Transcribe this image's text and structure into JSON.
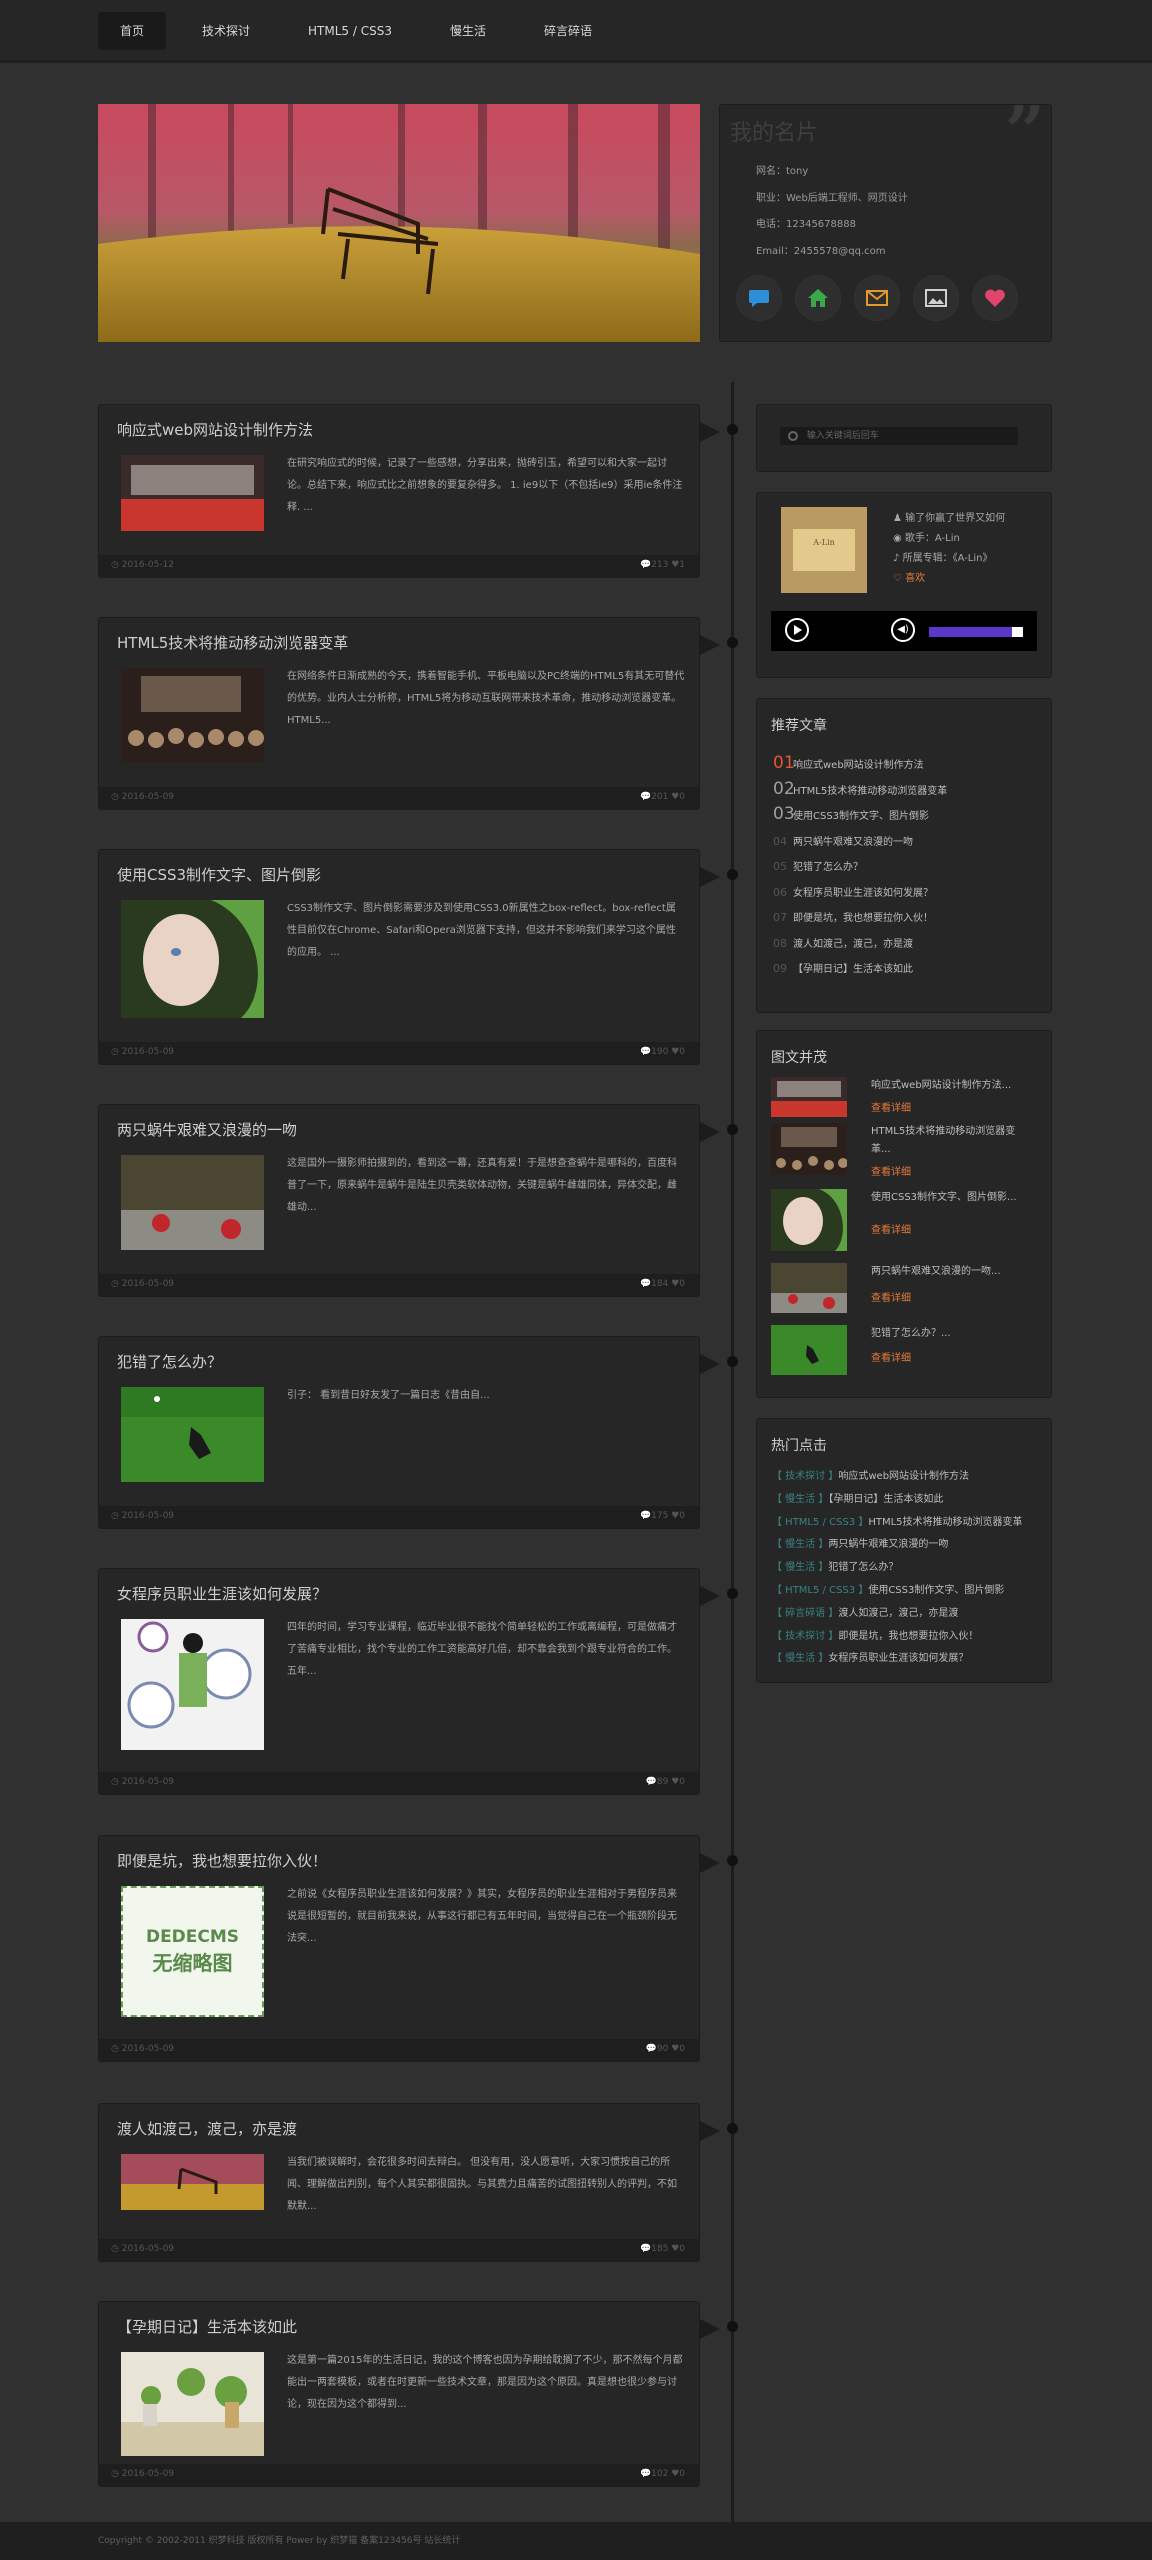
{
  "nav": [
    {
      "label": "首页",
      "active": true
    },
    {
      "label": "技术探讨",
      "active": false
    },
    {
      "label": "HTML5 / CSS3",
      "active": false
    },
    {
      "label": "慢生活",
      "active": false
    },
    {
      "label": "碎言碎语",
      "active": false
    }
  ],
  "profile": {
    "title": "我的名片",
    "name": "网名：tony",
    "job": "职业：Web后端工程师、网页设计",
    "phone": "电话：12345678888",
    "email": "Email：2455578@qq.com",
    "icons": [
      "chat-icon",
      "home-icon",
      "mail-icon",
      "picture-icon",
      "heart-icon"
    ]
  },
  "posts": [
    {
      "title": "响应式web网站设计制作方法",
      "excerpt": "在研究响应式的时候，记录了一些感想，分享出来，抛砖引玉，希望可以和大家一起讨论。总结下来，响应式比之前想象的要复杂得多。 1. ie9以下（不包括ie9）采用ie条件注释. ...",
      "date": "2016-05-12",
      "views": "213",
      "likes": "1"
    },
    {
      "title": "HTML5技术将推动移动浏览器变革",
      "excerpt": "在网络条件日渐成熟的今天，携着智能手机、平板电脑以及PC终端的HTML5有其无可替代的优势。业内人士分析称，HTML5将为移动互联网带来技术革命，推动移动浏览器变革。 HTML5...",
      "date": "2016-05-09",
      "views": "201",
      "likes": "0"
    },
    {
      "title": "使用CSS3制作文字、图片倒影",
      "excerpt": "CSS3制作文字、图片倒影需要涉及到使用CSS3.0新属性之box-reflect。box-reflect属性目前仅在Chrome、Safari和Opera浏览器下支持，但这并不影响我们来学习这个属性的应用。 ...",
      "date": "2016-05-09",
      "views": "190",
      "likes": "0"
    },
    {
      "title": "两只蜗牛艰难又浪漫的一吻",
      "excerpt": "这是国外一摄影师拍摄到的，看到这一幕，还真有爱！于是想查查蜗牛是哪科的，百度科普了一下，原来蜗牛是蜗牛是陆生贝壳类软体动物，关键是蜗牛雌雄同体，异体交配，雌雄动...",
      "date": "2016-05-09",
      "views": "184",
      "likes": "0"
    },
    {
      "title": "犯错了怎么办？",
      "excerpt": "引子：  看到昔日好友发了一篇日志《昔由自...",
      "date": "2016-05-09",
      "views": "175",
      "likes": "0"
    },
    {
      "title": "女程序员职业生涯该如何发展？",
      "excerpt": "四年的时间，学习专业课程，临近毕业很不能找个简单轻松的工作或离编程，可是做痛才了苦痛专业相比，找个专业的工作工资能高好几倍，却不靠会我到个跟专业符合的工作。五年...",
      "date": "2016-05-09",
      "views": "89",
      "likes": "0"
    },
    {
      "title": "即便是坑，我也想要拉你入伙！",
      "excerpt": "之前说《女程序员职业生涯该如何发展？》其实，女程序员的职业生涯相对于男程序员来说是很短暂的，就目前我来说，从事这行都已有五年时间，当觉得自己在一个瓶颈阶段无法突...",
      "date": "2016-05-09",
      "views": "90",
      "likes": "0",
      "placeholder_line1": "DEDECMS",
      "placeholder_line2": "无缩略图"
    },
    {
      "title": "渡人如渡己，渡己，亦是渡",
      "excerpt": "当我们被误解时，会花很多时间去辩白。 但没有用，没人愿意听，大家习惯按自己的所闻、理解做出判别，每个人其实都很固执。与其费力且痛苦的试图扭转别人的评判，不如默默...",
      "date": "2016-05-09",
      "views": "185",
      "likes": "0"
    },
    {
      "title": "【孕期日记】生活本该如此",
      "excerpt": "这是第一篇2015年的生活日记，我的这个博客也因为孕期给耽搁了不少，那不然每个月都能出一两套模板，或者在时更新一些技术文章，那是因为这个原因。真是想也很少参与讨论，现在因为这个都得到...",
      "date": "2016-05-09",
      "views": "102",
      "likes": "0"
    }
  ],
  "search": {
    "placeholder": "输入关键词后回车"
  },
  "player": {
    "track": "输了你赢了世界又如何",
    "singer": "歌手：A-Lin",
    "album": "所属专辑：《A-Lin》",
    "fav": "喜欢",
    "volume": 0.88
  },
  "recommend": {
    "title": "推荐文章",
    "items": [
      {
        "num": "01",
        "title": "响应式web网站设计制作方法"
      },
      {
        "num": "02",
        "title": "HTML5技术将推动移动浏览器变革"
      },
      {
        "num": "03",
        "title": "使用CSS3制作文字、图片倒影"
      },
      {
        "num": "04",
        "title": "两只蜗牛艰难又浪漫的一吻"
      },
      {
        "num": "05",
        "title": "犯错了怎么办？"
      },
      {
        "num": "06",
        "title": "女程序员职业生涯该如何发展？"
      },
      {
        "num": "07",
        "title": "即便是坑，我也想要拉你入伙！"
      },
      {
        "num": "08",
        "title": "渡人如渡己，渡己，亦是渡"
      },
      {
        "num": "09",
        "title": "【孕期日记】生活本该如此"
      }
    ]
  },
  "tuwen": {
    "title": "图文并茂",
    "more": "查看详细",
    "items": [
      {
        "title": "响应式web网站设计制作方法..."
      },
      {
        "title": "HTML5技术将推动移动浏览器变革..."
      },
      {
        "title": "使用CSS3制作文字、图片倒影..."
      },
      {
        "title": "两只蜗牛艰难又浪漫的一吻..."
      },
      {
        "title": "犯错了怎么办？..."
      }
    ]
  },
  "hot": {
    "title": "热门点击",
    "items": [
      {
        "cat": "技术探讨",
        "title": "响应式web网站设计制作方法"
      },
      {
        "cat": "慢生活",
        "title": "【孕期日记】生活本该如此"
      },
      {
        "cat": "HTML5 / CSS3",
        "title": "HTML5技术将推动移动浏览器变革"
      },
      {
        "cat": "慢生活",
        "title": "两只蜗牛艰难又浪漫的一吻"
      },
      {
        "cat": "慢生活",
        "title": "犯错了怎么办？"
      },
      {
        "cat": "HTML5 / CSS3",
        "title": "使用CSS3制作文字、图片倒影"
      },
      {
        "cat": "碎言碎语",
        "title": "渡人如渡己，渡己，亦是渡"
      },
      {
        "cat": "技术探讨",
        "title": "即便是坑，我也想要拉你入伙！"
      },
      {
        "cat": "慢生活",
        "title": "女程序员职业生涯该如何发展？"
      }
    ]
  },
  "footer": "Copyright © 2002-2011 织梦科技 版权所有 Power by 织梦猫 备案123456号 站长统计"
}
